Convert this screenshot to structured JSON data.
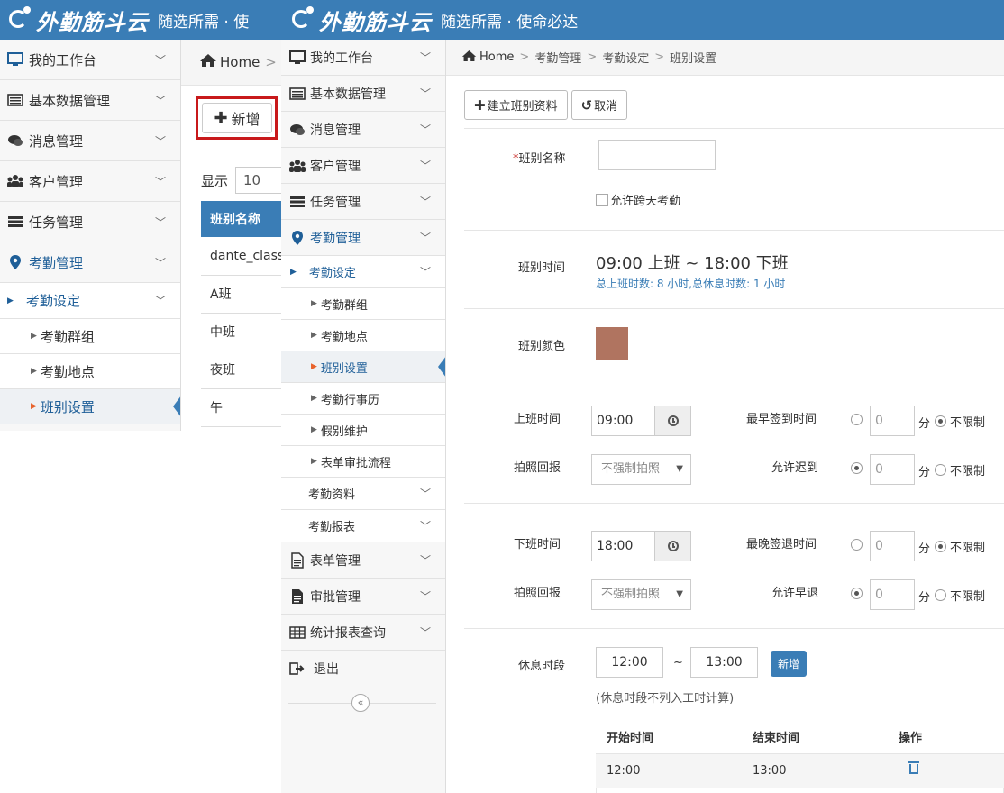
{
  "header": {
    "logo_text": "外勤筋斗云",
    "slogan": "随选所需 · 使命必达",
    "slogan_back": "随选所需 · 使"
  },
  "back_sidebar": {
    "items": [
      {
        "label": "我的工作台",
        "icon": "monitor-icon"
      },
      {
        "label": "基本数据管理",
        "icon": "list-icon"
      },
      {
        "label": "消息管理",
        "icon": "chat-icon"
      },
      {
        "label": "客户管理",
        "icon": "users-icon"
      },
      {
        "label": "任务管理",
        "icon": "tasks-icon"
      },
      {
        "label": "考勤管理",
        "icon": "map-pin-icon"
      }
    ],
    "sub": "考勤设定",
    "leaves": [
      "考勤群组",
      "考勤地点",
      "班别设置"
    ]
  },
  "back_main": {
    "breadcrumb_home": "Home",
    "breadcrumb_sep": ">",
    "new_button": "新增",
    "show_label": "显示",
    "show_value": "10",
    "table_header": "班别名称",
    "rows": [
      "dante_class",
      "A班",
      "中班",
      "夜班",
      "午"
    ]
  },
  "sidebar": {
    "items_top": [
      {
        "label": "我的工作台",
        "icon": "monitor-icon"
      },
      {
        "label": "基本数据管理",
        "icon": "list-icon"
      },
      {
        "label": "消息管理",
        "icon": "chat-icon"
      },
      {
        "label": "客户管理",
        "icon": "users-icon"
      },
      {
        "label": "任务管理",
        "icon": "tasks-icon"
      },
      {
        "label": "考勤管理",
        "icon": "map-pin-icon"
      }
    ],
    "sub_active": "考勤设定",
    "leaves": [
      "考勤群组",
      "考勤地点",
      "班别设置",
      "考勤行事历",
      "假别维护",
      "表单审批流程"
    ],
    "sub_others": [
      "考勤资料",
      "考勤报表"
    ],
    "items_bottom": [
      {
        "label": "表单管理",
        "icon": "form-icon"
      },
      {
        "label": "审批管理",
        "icon": "doc-icon"
      },
      {
        "label": "统计报表查询",
        "icon": "table-icon"
      },
      {
        "label": "退出",
        "icon": "logout-icon"
      }
    ],
    "collapse_glyph": "«"
  },
  "breadcrumb": {
    "home": "Home",
    "sep": ">",
    "items": [
      "考勤管理",
      "考勤设定",
      "班别设置"
    ]
  },
  "toolbar": {
    "create_label": "建立班别资料",
    "cancel_label": "取消"
  },
  "form": {
    "required_mark": "*",
    "name_label": "班别名称",
    "name_value": "",
    "cross_day_label": "允许跨天考勤",
    "shift_time_label": "班别时间",
    "shift_time_value": "09:00 上班 ~ 18:00 下班",
    "shift_hours_value": "总上班时数: 8 小时,总休息时数: 1 小时",
    "color_label": "班别颜色",
    "shift_color": "#b07460",
    "on_label": "上班时间",
    "on_time": "09:00",
    "earliest_label": "最早签到时间",
    "earliest_value": "0",
    "photo_label": "拍照回报",
    "photo_value": "不强制拍照",
    "late_label": "允许迟到",
    "late_value": "0",
    "off_label": "下班时间",
    "off_time": "18:00",
    "latest_label": "最晚签退时间",
    "latest_value": "0",
    "photo2_label": "拍照回报",
    "photo2_value": "不强制拍照",
    "early_label": "允许早退",
    "early_value": "0",
    "minute_unit": "分",
    "no_limit": "不限制",
    "break_label": "休息时段",
    "break_start": "12:00",
    "break_tilde": "~",
    "break_end": "13:00",
    "break_add": "新增",
    "break_note": "(休息时段不列入工时计算)"
  },
  "break_table": {
    "headers": [
      "开始时间",
      "结束时间",
      "操作"
    ],
    "rows": [
      {
        "start": "12:00",
        "end": "13:00"
      }
    ]
  }
}
